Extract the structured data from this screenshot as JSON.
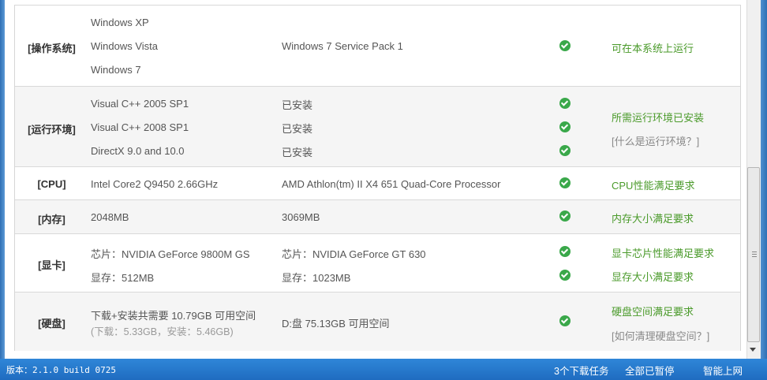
{
  "sections": {
    "os": {
      "category": "[操作系统]",
      "required": [
        "Windows XP",
        "Windows Vista",
        "Windows 7"
      ],
      "current": "Windows 7 Service Pack 1",
      "result": "可在本系统上运行"
    },
    "runtime": {
      "category": "[运行环境]",
      "items": [
        {
          "required": "Visual C++ 2005 SP1",
          "current": "已安装"
        },
        {
          "required": "Visual C++ 2008 SP1",
          "current": "已安装"
        },
        {
          "required": "DirectX 9.0 and 10.0",
          "current": "已安装"
        }
      ],
      "result": "所需运行环境已安装",
      "help_link": "[什么是运行环境？]"
    },
    "cpu": {
      "category": "[CPU]",
      "required": "Intel Core2 Q9450 2.66GHz",
      "current": "AMD Athlon(tm) II X4 651 Quad-Core Processor",
      "result": "CPU性能满足要求"
    },
    "memory": {
      "category": "[内存]",
      "required": "2048MB",
      "current": "3069MB",
      "result": "内存大小满足要求"
    },
    "gpu": {
      "category": "[显卡]",
      "chip_required": "芯片：NVIDIA GeForce 9800M GS",
      "chip_current": "芯片：NVIDIA GeForce GT 630",
      "chip_result": "显卡芯片性能满足要求",
      "vram_required": "显存：512MB",
      "vram_current": "显存：1023MB",
      "vram_result": "显存大小满足要求"
    },
    "disk": {
      "category": "[硬盘]",
      "required": "下载+安装共需要  10.79GB 可用空间",
      "required_detail": "(下载：5.33GB，安装：5.46GB)",
      "current": "D:盘  75.13GB 可用空间",
      "result": "硬盘空间满足要求",
      "help_link": "[如何清理硬盘空间？]"
    }
  },
  "status_bar": {
    "version": "版本：2.1.0 build 0725",
    "downloads": "3个下载任务",
    "pause_all": "全部已暂停",
    "network": "智能上网"
  },
  "colors": {
    "ok": "#3aa84a",
    "result_text": "#4a9a2a",
    "status_bar": "#2f86d8"
  }
}
